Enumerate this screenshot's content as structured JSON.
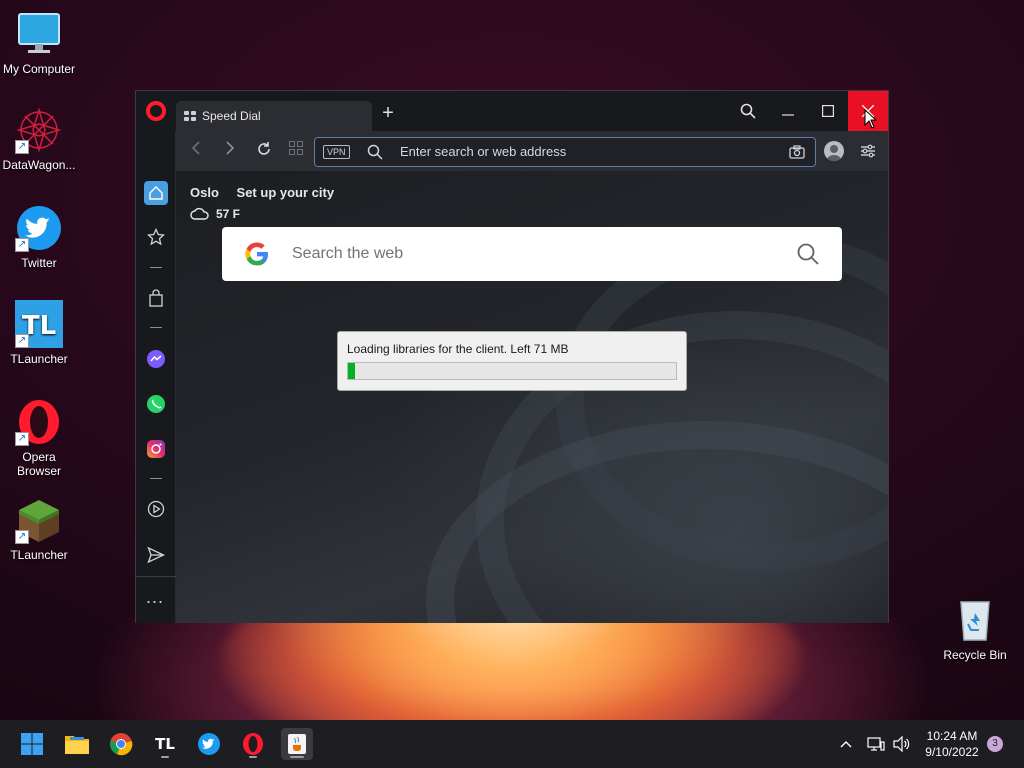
{
  "desktop": {
    "icons": [
      {
        "label": "My Computer"
      },
      {
        "label": "DataWagon..."
      },
      {
        "label": "Twitter"
      },
      {
        "label": "TLauncher"
      },
      {
        "label": "Opera Browser"
      },
      {
        "label": "TLauncher"
      },
      {
        "label": "Recycle Bin"
      }
    ],
    "tlauncher_logo_text": "TL"
  },
  "browser": {
    "tab_title": "Speed Dial",
    "new_tab": "+",
    "address_bar": {
      "vpn_label": "VPN",
      "placeholder": "Enter search or web address"
    },
    "speed_dial": {
      "city": "Oslo",
      "setup_city": "Set up your city",
      "temperature": "57 F",
      "search_placeholder": "Search the web"
    },
    "sidebar_more": "..."
  },
  "dialog": {
    "message": "Loading libraries for the client. Left 71 MB",
    "progress_percent": 2
  },
  "taskbar": {
    "apps": [
      "start",
      "file-explorer",
      "chrome",
      "tlauncher",
      "twitter",
      "opera",
      "java"
    ],
    "tlauncher_label": "TL",
    "time": "10:24 AM",
    "date": "9/10/2022",
    "notification_count": "3"
  },
  "colors": {
    "opera_red": "#ff1b2d",
    "close_red": "#e81123",
    "progress_green": "#06b025",
    "accent_blue": "#4a9fe0"
  }
}
